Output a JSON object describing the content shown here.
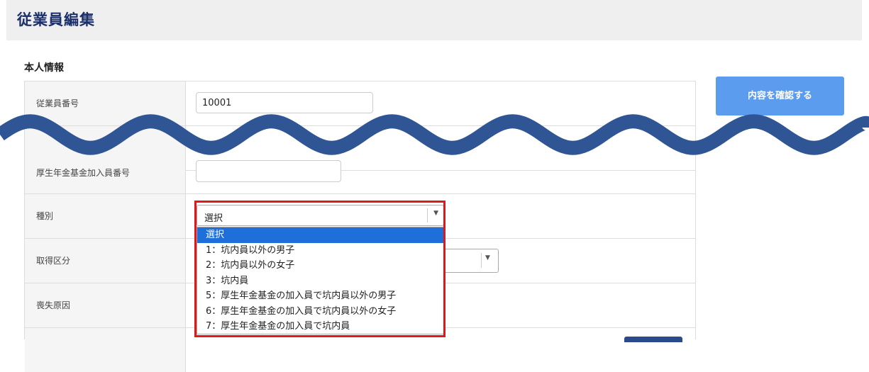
{
  "page": {
    "title": "従業員編集"
  },
  "section": {
    "title": "本人情報"
  },
  "buttons": {
    "confirm": "内容を確認する"
  },
  "fields": {
    "employee_number": {
      "label": "従業員番号",
      "value": "10001"
    },
    "pension_fund_number": {
      "label": "厚生年金基金加入員番号",
      "value": ""
    },
    "category": {
      "label": "種別",
      "selected": "選択"
    },
    "acquisition_type": {
      "label": "取得区分"
    },
    "loss_reason": {
      "label": "喪失原因"
    }
  },
  "category_options": [
    "選択",
    "1：坑内員以外の男子",
    "2：坑内員以外の女子",
    "3：坑内員",
    "5：厚生年金基金の加入員で坑内員以外の男子",
    "6：厚生年金基金の加入員で坑内員以外の女子",
    "7：厚生年金基金の加入員で坑内員"
  ],
  "colors": {
    "title": "#1b2f6b",
    "button": "#5b9cee",
    "highlight": "#e01818",
    "selected_option": "#1e6fd9",
    "wave": "#2f5595"
  }
}
